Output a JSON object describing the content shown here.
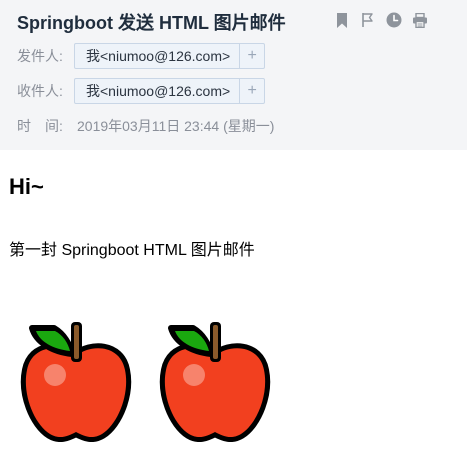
{
  "email": {
    "subject": "Springboot 发送 HTML 图片邮件",
    "from_label": "发件人:",
    "from_address": "我<niumoo@126.com>",
    "to_label": "收件人:",
    "to_address": "我<niumoo@126.com>",
    "add_symbol": "+",
    "time_label": "时　间:",
    "time_value": "2019年03月11日 23:44 (星期一)"
  },
  "toolbar": {
    "icons": [
      "bookmark-icon",
      "flag-icon",
      "clock-icon",
      "print-icon"
    ]
  },
  "content": {
    "heading": "Hi~",
    "paragraph": "第一封 Springboot HTML 图片邮件",
    "images": [
      "apple-image",
      "apple-image"
    ]
  },
  "colors": {
    "header_bg": "#f4f5f7",
    "apple_red": "#f2401f",
    "leaf_green": "#1aa80f"
  }
}
